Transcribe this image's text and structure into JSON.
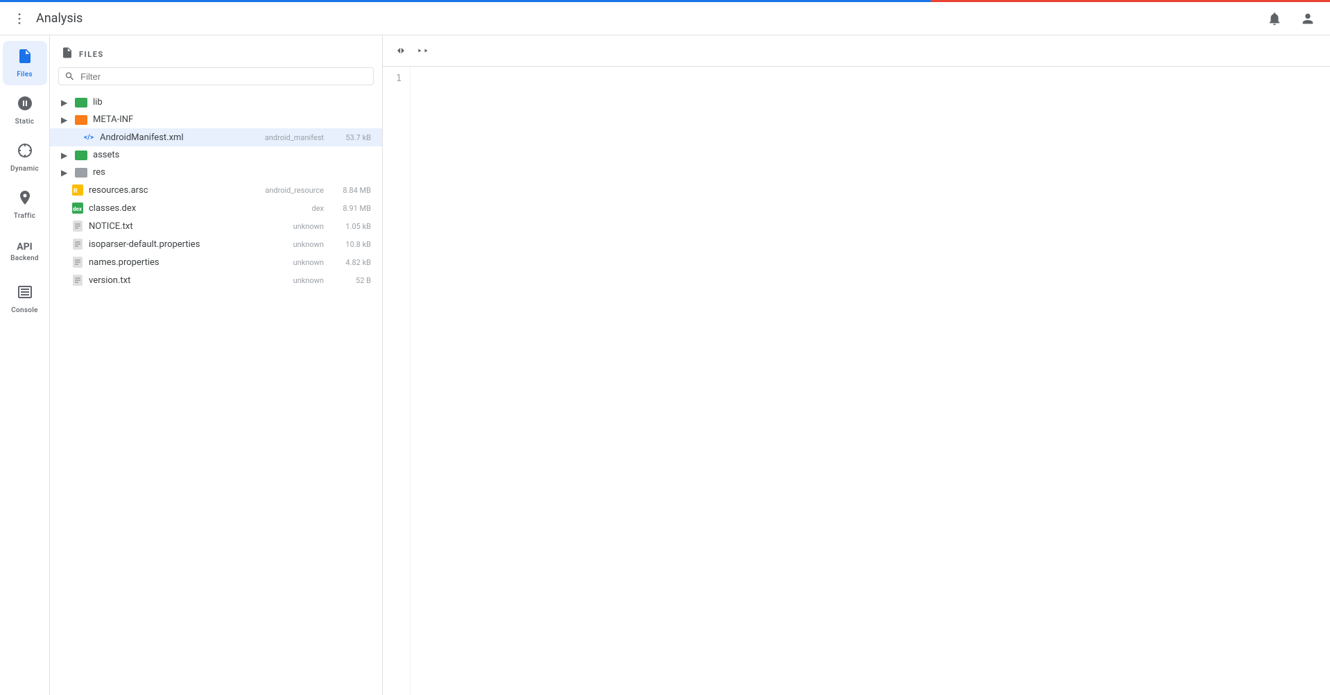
{
  "app": {
    "title": "Analysis",
    "progress_left_color": "#1a73e8",
    "progress_right_color": "#ea4335"
  },
  "topbar": {
    "menu_label": "⋮",
    "title": "Analysis",
    "bell_icon": "🔔",
    "user_icon": "👤"
  },
  "sidebar": {
    "items": [
      {
        "id": "files",
        "label": "Files",
        "icon": "📄",
        "active": true
      },
      {
        "id": "static",
        "label": "Static",
        "icon": "🔬",
        "active": false
      },
      {
        "id": "dynamic",
        "label": "Dynamic",
        "icon": "⚡",
        "active": false
      },
      {
        "id": "traffic",
        "label": "Traffic",
        "icon": "🌐",
        "active": false
      },
      {
        "id": "backend",
        "label": "Backend",
        "icon": "API",
        "active": false
      },
      {
        "id": "console",
        "label": "Console",
        "icon": "▥",
        "active": false
      }
    ]
  },
  "files_panel": {
    "header_title": "FILES",
    "search_placeholder": "Filter",
    "tree": [
      {
        "type": "folder",
        "name": "lib",
        "color": "green",
        "expanded": false,
        "indent": 0
      },
      {
        "type": "folder",
        "name": "META-INF",
        "color": "orange",
        "expanded": false,
        "indent": 0
      },
      {
        "type": "file",
        "name": "AndroidManifest.xml",
        "file_type": "xml",
        "meta_type": "android_manifest",
        "meta_size": "53.7 kB",
        "selected": true,
        "indent": 1
      },
      {
        "type": "folder",
        "name": "assets",
        "color": "green",
        "expanded": false,
        "indent": 0
      },
      {
        "type": "folder",
        "name": "res",
        "color": "gray",
        "expanded": false,
        "indent": 0
      },
      {
        "type": "file",
        "name": "resources.arsc",
        "file_type": "resource",
        "meta_type": "android_resource",
        "meta_size": "8.84 MB",
        "selected": false,
        "indent": 0
      },
      {
        "type": "file",
        "name": "classes.dex",
        "file_type": "dex",
        "meta_type": "dex",
        "meta_size": "8.91 MB",
        "selected": false,
        "indent": 0
      },
      {
        "type": "file",
        "name": "NOTICE.txt",
        "file_type": "doc",
        "meta_type": "unknown",
        "meta_size": "1.05 kB",
        "selected": false,
        "indent": 0
      },
      {
        "type": "file",
        "name": "isoparser-default.properties",
        "file_type": "doc",
        "meta_type": "unknown",
        "meta_size": "10.8 kB",
        "selected": false,
        "indent": 0
      },
      {
        "type": "file",
        "name": "names.properties",
        "file_type": "doc",
        "meta_type": "unknown",
        "meta_size": "4.82 kB",
        "selected": false,
        "indent": 0
      },
      {
        "type": "file",
        "name": "version.txt",
        "file_type": "doc",
        "meta_type": "unknown",
        "meta_size": "52 B",
        "selected": false,
        "indent": 0
      }
    ]
  },
  "editor": {
    "collapse_icon": "⟵",
    "expand_icon": "⟶",
    "line_numbers": [
      "1"
    ]
  }
}
